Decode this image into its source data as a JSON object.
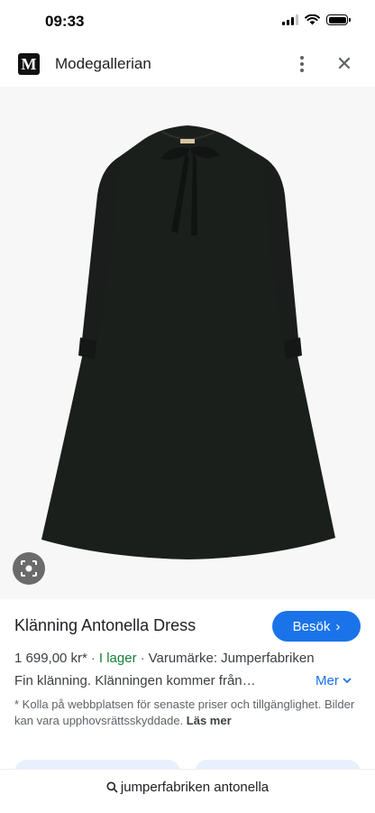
{
  "status_bar": {
    "time": "09:33"
  },
  "header": {
    "site_name": "Modegallerian",
    "logo_letter": "M"
  },
  "product": {
    "title": "Klänning Antonella Dress",
    "price": "1 699,00 kr*",
    "stock": "I lager",
    "brand": "Varumärke: Jumperfabriken",
    "description": "Fin klänning. Klänningen kommer från…",
    "more_label": "Mer",
    "disclaimer": "* Kolla på webbplatsen för senaste priser och tillgänglighet. Bilder kan vara upphovsrättsskyddade.",
    "read_more": "Läs mer"
  },
  "actions": {
    "visit_label": "Besök"
  },
  "search": {
    "query": "jumperfabriken antonella"
  },
  "colors": {
    "accent": "#1a73e8",
    "in_stock": "#188038",
    "dress": "#1b1f1c"
  }
}
